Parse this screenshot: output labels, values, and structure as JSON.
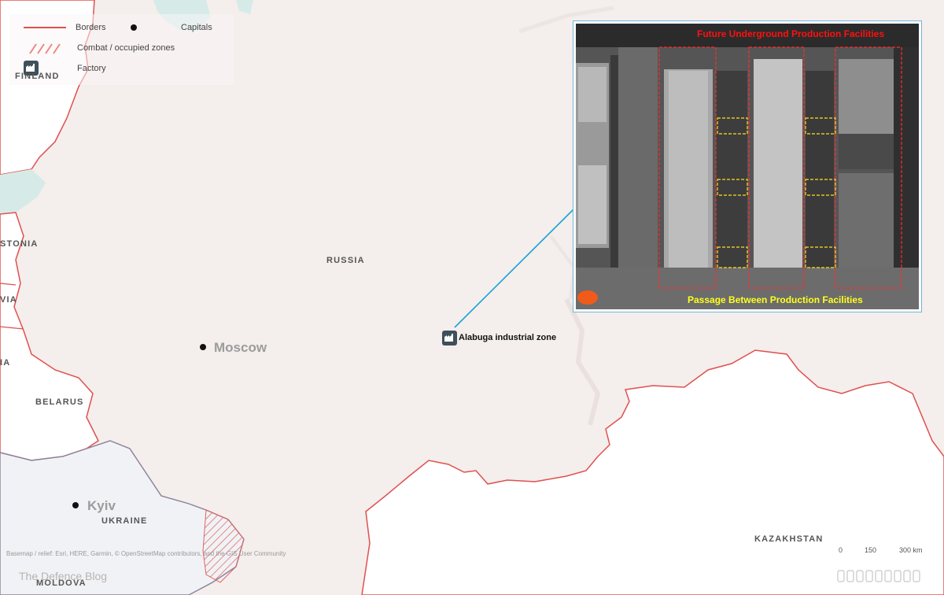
{
  "legend": {
    "borders": "Borders",
    "capitals": "Capitals",
    "combat_zones": "Combat / occupied zones",
    "factory": "Factory"
  },
  "countries": {
    "finland": "FINLAND",
    "estonia": "STONIA",
    "latvia": "VIA",
    "lithuania": "IA",
    "belarus": "BELARUS",
    "ukraine": "UKRAINE",
    "moldova": "MOLDOVA",
    "russia": "RUSSIA",
    "kazakhstan": "KAZAKHSTAN"
  },
  "capitals": {
    "moscow": "Moscow",
    "kyiv": "Kyiv"
  },
  "factory_site": {
    "label": "Alabuga industrial zone"
  },
  "inset": {
    "top_caption": "Future Underground Production Facilities",
    "bottom_caption": "Passage Between Production Facilities"
  },
  "scale_bar": {
    "ticks": [
      "0",
      "150",
      "300 km"
    ]
  },
  "attribution": "Basemap / relief: Esri, HERE, Garmin, © OpenStreetMap contributors, and the GIS User Community",
  "watermark": "The Defence Blog",
  "colors": {
    "border": "#e05050",
    "russia_fill": "#f4eeec",
    "neighbor_fill": "#ffffff",
    "ukraine_fill": "#f1f2f5",
    "water": "#d6ebe8",
    "leader_line": "#1aa3d6",
    "inset_caption_top": "#ff1010",
    "inset_caption_bottom": "#ffff20"
  }
}
